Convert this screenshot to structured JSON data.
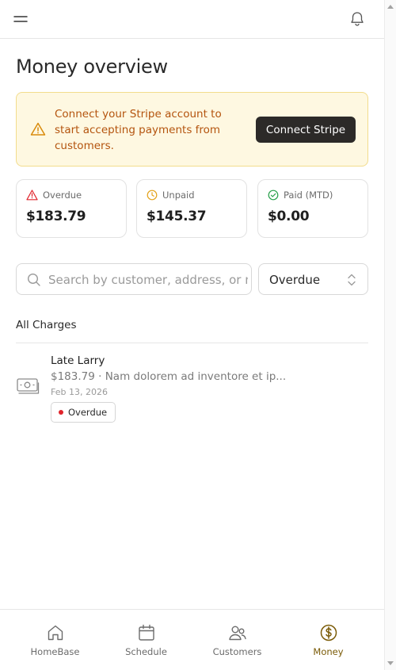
{
  "header": {
    "menu_icon": "menu-icon",
    "bell_icon": "bell-icon"
  },
  "page": {
    "title": "Money overview"
  },
  "banner": {
    "icon": "warning-icon",
    "text": "Connect your Stripe account to start accepting payments from customers.",
    "button_label": "Connect Stripe",
    "text_color": "#b4540e",
    "background": "#fef8e1"
  },
  "stats": [
    {
      "label": "Overdue",
      "value": "$183.79",
      "icon": "alert-triangle-icon",
      "color": "#e0242b"
    },
    {
      "label": "Unpaid",
      "value": "$145.37",
      "icon": "clock-icon",
      "color": "#e3a21a"
    },
    {
      "label": "Paid (MTD)",
      "value": "$0.00",
      "icon": "check-circle-icon",
      "color": "#27a04a"
    }
  ],
  "search": {
    "placeholder": "Search by customer, address, or n",
    "value": ""
  },
  "filter": {
    "selected": "Overdue"
  },
  "charges": {
    "section_title": "All Charges",
    "items": [
      {
        "name": "Late Larry",
        "description": "$183.79 · Nam dolorem ad inventore et ip...",
        "date": "Feb 13, 2026",
        "status": "Overdue",
        "icon": "cash-icon"
      }
    ]
  },
  "nav": {
    "items": [
      {
        "label": "HomeBase",
        "icon": "home-icon"
      },
      {
        "label": "Schedule",
        "icon": "calendar-icon"
      },
      {
        "label": "Customers",
        "icon": "users-icon"
      },
      {
        "label": "Money",
        "icon": "dollar-circle-icon",
        "active": true
      }
    ],
    "active_color": "#7a5a06"
  }
}
